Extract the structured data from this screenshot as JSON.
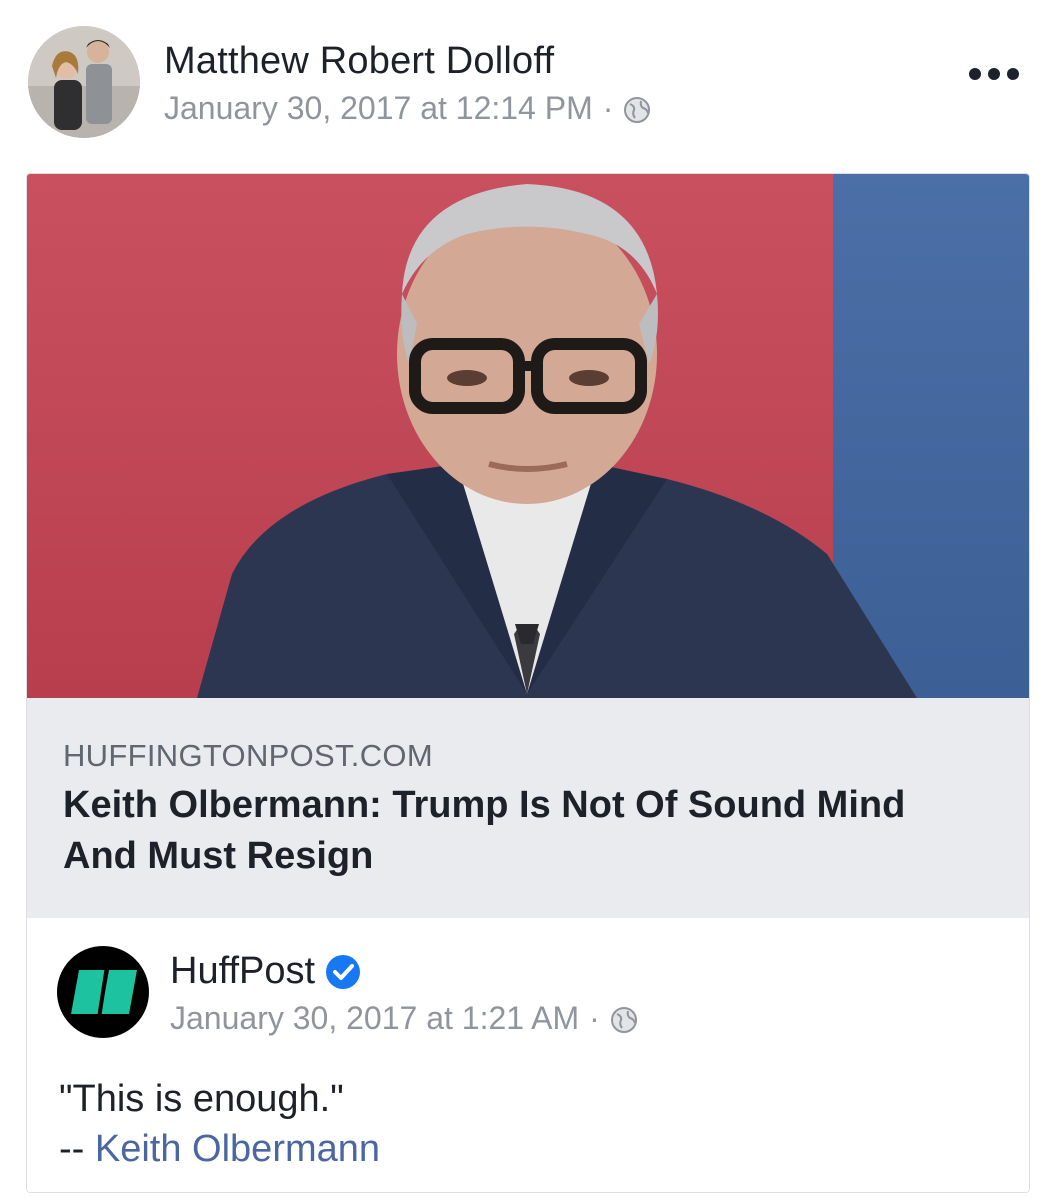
{
  "post": {
    "author_name": "Matthew Robert Dolloff",
    "timestamp": "January 30, 2017 at 12:14 PM",
    "separator": "·",
    "privacy_icon": "globe-icon",
    "more_icon": "more-options-icon"
  },
  "link_preview": {
    "domain": "HUFFINGTONPOST.COM",
    "title": "Keith Olbermann: Trump Is Not Of Sound Mind And Must Resign"
  },
  "shared_post": {
    "page_name": "HuffPost",
    "verified_icon": "verified-badge-icon",
    "timestamp": "January 30, 2017 at 1:21 AM",
    "separator": "·",
    "quote": "\"This is enough.\"",
    "attribution_prefix": "-- ",
    "attribution_link": "Keith Olbermann"
  },
  "colors": {
    "text_primary": "#1d2129",
    "text_secondary": "#90949c",
    "link_blue": "#4b67a1",
    "verified_blue": "#1877f2",
    "huffpost_green": "#1dc29e"
  }
}
